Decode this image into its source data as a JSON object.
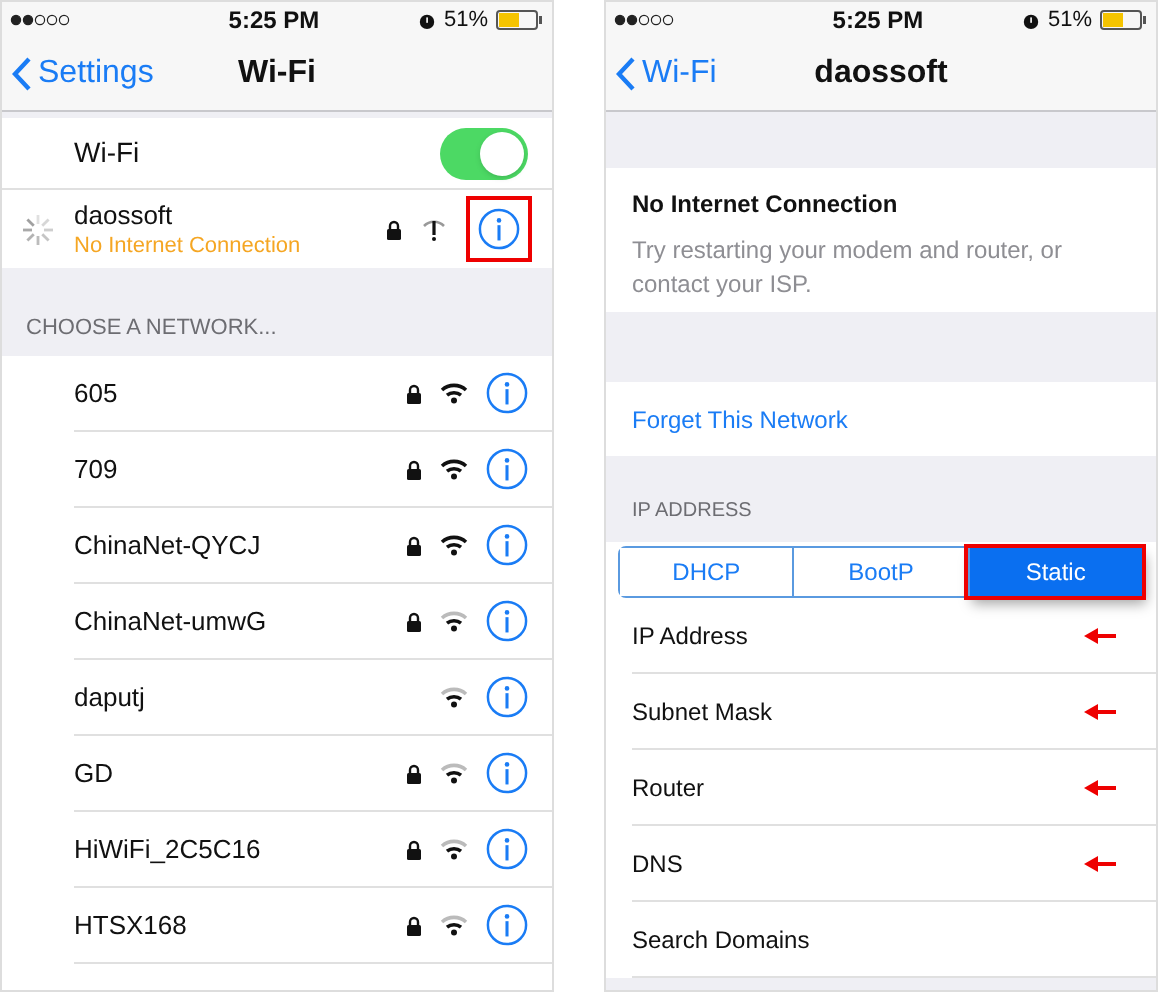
{
  "left_screen": {
    "status_bar": {
      "time": "5:25 PM",
      "battery": "51%"
    },
    "nav": {
      "back": "Settings",
      "title": "Wi-Fi"
    },
    "wifi_toggle": {
      "label": "Wi-Fi",
      "on": true
    },
    "current_network": {
      "name": "daossoft",
      "status": "No Internet Connection",
      "highlighted": true
    },
    "section_header": "CHOOSE A NETWORK...",
    "networks": [
      {
        "name": "605",
        "locked": true,
        "weak_signal": false
      },
      {
        "name": "709",
        "locked": true,
        "weak_signal": false
      },
      {
        "name": "ChinaNet-QYCJ",
        "locked": true,
        "weak_signal": false
      },
      {
        "name": "ChinaNet-umwG",
        "locked": true,
        "weak_signal": true
      },
      {
        "name": "daputj",
        "locked": false,
        "weak_signal": true
      },
      {
        "name": "GD",
        "locked": true,
        "weak_signal": true
      },
      {
        "name": "HiWiFi_2C5C16",
        "locked": true,
        "weak_signal": true
      },
      {
        "name": "HTSX168",
        "locked": true,
        "weak_signal": true
      }
    ]
  },
  "right_screen": {
    "status_bar": {
      "time": "5:25 PM",
      "battery": "51%"
    },
    "nav": {
      "back": "Wi-Fi",
      "title": "daossoft"
    },
    "notice": {
      "title": "No Internet Connection",
      "text": "Try restarting your modem and router, or contact your ISP."
    },
    "forget": "Forget This Network",
    "section_header": "IP ADDRESS",
    "segments": [
      {
        "label": "DHCP",
        "selected": false,
        "highlighted": false
      },
      {
        "label": "BootP",
        "selected": false,
        "highlighted": false
      },
      {
        "label": "Static",
        "selected": true,
        "highlighted": true
      }
    ],
    "fields": [
      {
        "label": "IP Address",
        "marked": true
      },
      {
        "label": "Subnet Mask",
        "marked": true
      },
      {
        "label": "Router",
        "marked": true
      },
      {
        "label": "DNS",
        "marked": true
      },
      {
        "label": "Search Domains",
        "marked": false
      }
    ]
  }
}
